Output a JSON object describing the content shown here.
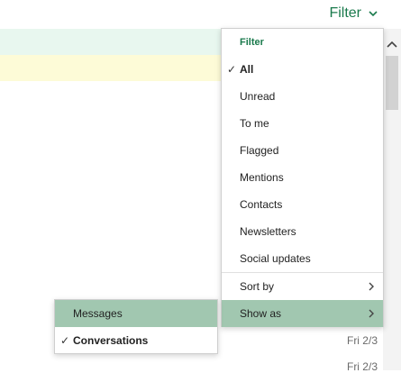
{
  "filter_button": {
    "label": "Filter",
    "icon": "chevron-down-icon"
  },
  "dropdown": {
    "header": "Filter",
    "items": [
      {
        "label": "All",
        "checked": true
      },
      {
        "label": "Unread"
      },
      {
        "label": "To me"
      },
      {
        "label": "Flagged"
      },
      {
        "label": "Mentions"
      },
      {
        "label": "Contacts"
      },
      {
        "label": "Newsletters"
      },
      {
        "label": "Social updates"
      }
    ],
    "sort_by": "Sort by",
    "show_as": "Show as"
  },
  "submenu": {
    "items": [
      {
        "label": "Messages"
      },
      {
        "label": "Conversations",
        "checked": true
      }
    ]
  },
  "dates": [
    "Fri 2/3",
    "Fri 2/3"
  ],
  "colors": {
    "accent_green": "#1a7a4c",
    "highlight_green": "#a1c7b0",
    "row_green": "#e8f7ef",
    "row_yellow": "#fdfbd7"
  }
}
